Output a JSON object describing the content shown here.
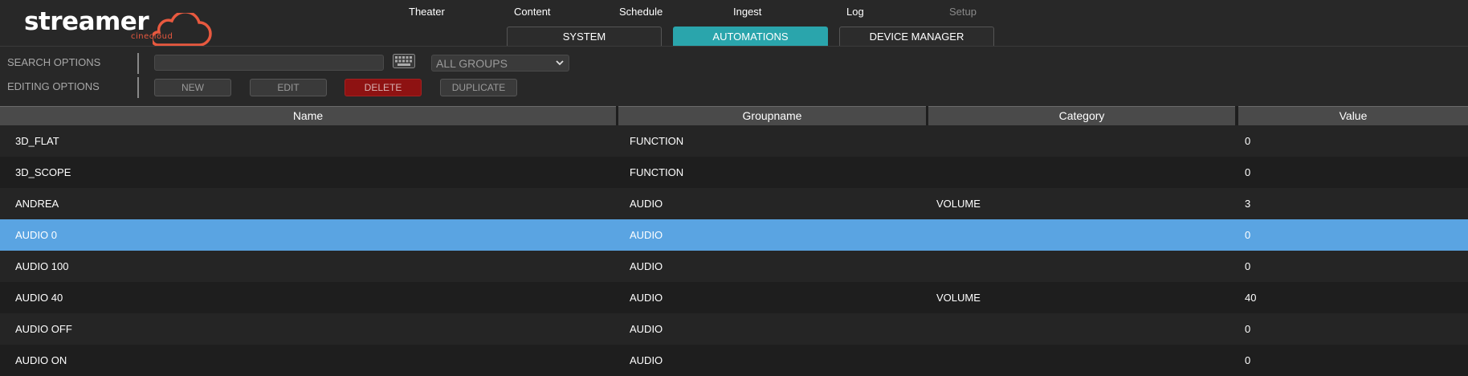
{
  "app": {
    "logo_text": "streamer",
    "logo_sub": "cinecloud",
    "brand_color": "#e8593f"
  },
  "topnav": {
    "items": [
      {
        "label": "Theater"
      },
      {
        "label": "Content"
      },
      {
        "label": "Schedule"
      },
      {
        "label": "Ingest"
      },
      {
        "label": "Log"
      },
      {
        "label": "Setup",
        "disabled": true
      }
    ]
  },
  "subtabs": {
    "items": [
      {
        "label": "SYSTEM"
      },
      {
        "label": "AUTOMATIONS",
        "active": true
      },
      {
        "label": "DEVICE MANAGER"
      }
    ],
    "active_color": "#2aa5ac"
  },
  "options": {
    "search_label": "SEARCH OPTIONS",
    "editing_label": "EDITING OPTIONS",
    "search_value": "",
    "keyboard_icon": "keyboard-icon",
    "group_select_value": "ALL GROUPS",
    "buttons": {
      "new": "NEW",
      "edit": "EDIT",
      "delete": "DELETE",
      "duplicate": "DUPLICATE"
    }
  },
  "table": {
    "columns": [
      "Name",
      "Groupname",
      "Category",
      "Value"
    ],
    "rows": [
      {
        "name": "3D_FLAT",
        "groupname": "FUNCTION",
        "category": "",
        "value": "0"
      },
      {
        "name": "3D_SCOPE",
        "groupname": "FUNCTION",
        "category": "",
        "value": "0"
      },
      {
        "name": "ANDREA",
        "groupname": "AUDIO",
        "category": "VOLUME",
        "value": "3"
      },
      {
        "name": "AUDIO 0",
        "groupname": "AUDIO",
        "category": "",
        "value": "0",
        "selected": true
      },
      {
        "name": "AUDIO 100",
        "groupname": "AUDIO",
        "category": "",
        "value": "0"
      },
      {
        "name": "AUDIO 40",
        "groupname": "AUDIO",
        "category": "VOLUME",
        "value": "40"
      },
      {
        "name": "AUDIO OFF",
        "groupname": "AUDIO",
        "category": "",
        "value": "0"
      },
      {
        "name": "AUDIO ON",
        "groupname": "AUDIO",
        "category": "",
        "value": "0"
      }
    ],
    "selected_color": "#5aa4e2"
  }
}
